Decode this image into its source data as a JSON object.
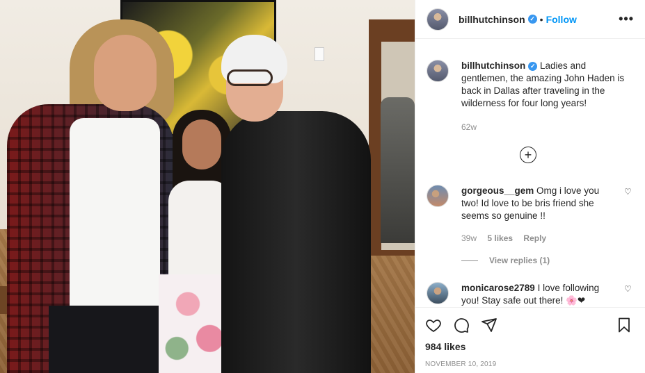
{
  "photo": {
    "caption_alt": ""
  },
  "header": {
    "username": "billhutchinson",
    "verified_glyph": "✓",
    "separator": "•",
    "follow_label": "Follow",
    "more_icon": "more-options-icon"
  },
  "caption": {
    "username": "billhutchinson",
    "text": "Ladies and gentlemen, the amazing John Haden is back in Dallas after traveling in the wilderness for four long years!",
    "age": "62w"
  },
  "load_more": {
    "glyph": "+"
  },
  "comments": [
    {
      "username": "gorgeous__gem",
      "text": "Omg i love you two! Id love to be bris friend she seems so genuine !!",
      "age": "39w",
      "likes": "5 likes",
      "reply_label": "Reply",
      "view_replies": "View replies (1)"
    },
    {
      "username": "monicarose2789",
      "text": "I love following you! Stay safe out there! 🌸❤"
    }
  ],
  "actions": {
    "likes": "984 likes",
    "date": "NOVEMBER 10, 2019"
  },
  "colors": {
    "accent": "#0095f6",
    "verified": "#3897f0",
    "muted": "#8e8e8e",
    "text": "#262626"
  }
}
